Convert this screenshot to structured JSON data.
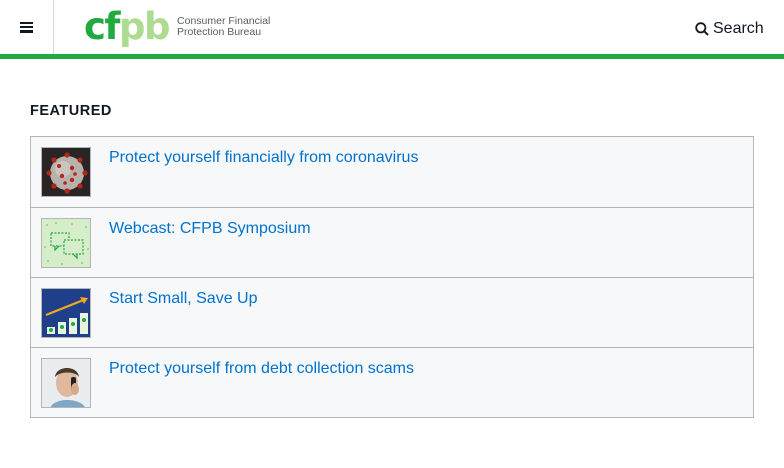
{
  "header": {
    "logo_mark_left": "cf",
    "logo_mark_right": "pb",
    "logo_line1": "Consumer Financial",
    "logo_line2": "Protection Bureau",
    "search_label": "Search",
    "accent_color": "#20aa3f"
  },
  "featured": {
    "heading": "FEATURED",
    "items": [
      {
        "label": "Protect yourself financially from coronavirus",
        "icon": "coronavirus-image"
      },
      {
        "label": "Webcast: CFPB Symposium",
        "icon": "chat-bubbles-image"
      },
      {
        "label": "Start Small, Save Up",
        "icon": "savings-growth-image"
      },
      {
        "label": "Protect yourself from debt collection scams",
        "icon": "man-on-phone-image"
      }
    ]
  },
  "link_color": "#0072ce"
}
